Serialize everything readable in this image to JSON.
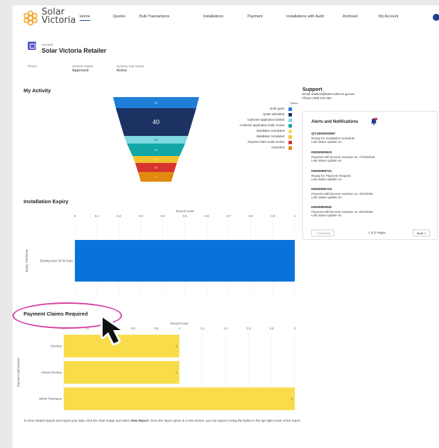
{
  "brand": {
    "line1": "Solar",
    "line2": "Victoria"
  },
  "nav": [
    {
      "label": "Home",
      "active": true
    },
    {
      "label": "Quotes"
    },
    {
      "label": "Bulk Transactions"
    },
    {
      "label": "Installations"
    },
    {
      "label": "Payment"
    },
    {
      "label": "Installations with Audit"
    },
    {
      "label": "Archived"
    },
    {
      "label": "My Account"
    }
  ],
  "account": {
    "label": "Account",
    "name": "Solar Victoria Retailer",
    "fields": [
      {
        "label": "Phone",
        "value": ""
      },
      {
        "label": "Scheme Status",
        "value": "Approved"
      },
      {
        "label": "Scheme Sub Status",
        "value": "Active"
      }
    ]
  },
  "my_activity": {
    "title": "My Activity",
    "legend_title": "Status"
  },
  "installation_expiry": {
    "title": "Installation Expiry",
    "axis_label": "Record Count",
    "y_axis_label": "Expiry Timeframe"
  },
  "payment_claims": {
    "title": "Payment Claims Required",
    "axis_label": "Record Count",
    "y_axis_label": "Payment Submissions"
  },
  "support": {
    "title": "Support",
    "email": "Email retailers@team.solar.vic.gov.au",
    "phone": "Phone 1300 376 393"
  },
  "alerts": {
    "title": "Alerts and Notifications",
    "items": [
      {
        "code": "QT-0000000687",
        "line1": "Ready for Installation Schedule",
        "line2": "Last status update on:"
      },
      {
        "code": "INS00900823",
        "line1": "Payment will become overdue on: 17/04/2026",
        "line2": "Last status update on:"
      },
      {
        "code": "INS00900721",
        "line1": "Ready for Payment Request",
        "line2": "Last status update on:"
      },
      {
        "code": "INS00900723",
        "line1": "Payment will become overdue on: 4/02/2026",
        "line2": "Last status update on:"
      },
      {
        "code": "INS00900642",
        "line1": "Payment will become overdue on: 6/02/2026",
        "line2": "Last status update on:"
      }
    ],
    "prev_label": "< Previous",
    "page_text": "1 of 2 Pages",
    "next_label": "Next >"
  },
  "footnote": {
    "before": "To view related reports and export your data, click the chart image and select ",
    "emphasis": "View Report",
    "after": ". Once the report opens in a new screen, you can export it using the button in the top right corner of the report."
  },
  "colors": {
    "draft": "#1f7fd8",
    "submitted": "#1b3263",
    "app_started": "#7fd8e0",
    "app_review": "#12a6a6",
    "install_scheduled": "#f7dc6b",
    "install_completed": "#f2c230",
    "claim_review": "#d8332f",
    "cancelled": "#e08a10",
    "bar_blue": "#0a73d9",
    "bar_yellow": "#f9dc4a"
  },
  "chart_data": [
    {
      "type": "funnel",
      "title": "My Activity",
      "legend_title": "Status",
      "categories": [
        "Draft quote",
        "Quote submitted",
        "Customer application started",
        "Customer application under review",
        "Installation scheduled",
        "Installation completed",
        "Payment claim under review",
        "Cancelled"
      ],
      "values": [
        24,
        40,
        10,
        14,
        null,
        7,
        16,
        7
      ],
      "value_labels": [
        "24",
        "40",
        "10",
        "14",
        "",
        "7",
        "16",
        "7"
      ]
    },
    {
      "type": "bar",
      "orientation": "horizontal",
      "title": "Installation Expiry",
      "xlabel": "Record Count",
      "ylabel": "Expiry Timeframe",
      "categories": [
        "Expiring Next 30-60 Days"
      ],
      "values": [
        1
      ],
      "xlim": [
        0,
        1
      ],
      "ticks": [
        "0",
        "0.1",
        "0.2",
        "0.3",
        "0.4",
        "0.5",
        "0.6",
        "0.7",
        "0.8",
        "0.9",
        "1"
      ]
    },
    {
      "type": "bar",
      "orientation": "horizontal",
      "title": "Payment Claims Required",
      "xlabel": "Record Count",
      "ylabel": "Payment Submissions",
      "categories": [
        "Overdue",
        "Almost Overdue",
        "Within Timeframe"
      ],
      "values": [
        1,
        1,
        2
      ],
      "xlim": [
        0,
        2
      ],
      "ticks": [
        "0",
        "0.2",
        "0.4",
        "0.6",
        "0.8",
        "1",
        "1.2",
        "1.4",
        "1.6",
        "1.8",
        "2"
      ]
    }
  ]
}
